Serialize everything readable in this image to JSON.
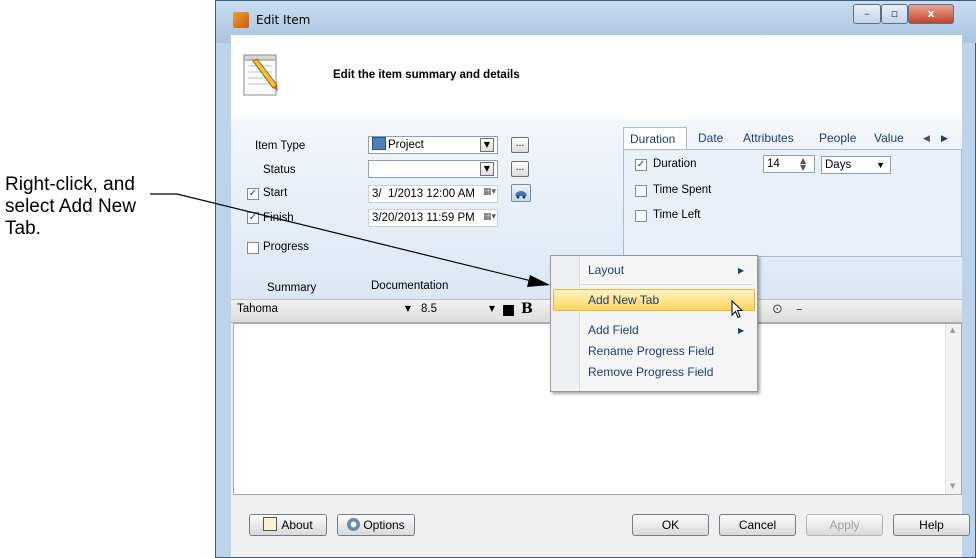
{
  "callout": {
    "line1": "Right-click, and",
    "line2": "select Add New",
    "line3": "Tab."
  },
  "window": {
    "title": "Edit Item",
    "minimize": "–",
    "maximize": "▫",
    "close": "x"
  },
  "header": {
    "text": "Edit the item summary and details"
  },
  "form": {
    "item_type_label": "Item Type",
    "item_type_value": "Project",
    "status_label": "Status",
    "status_value": "",
    "start_label": "Start",
    "start_value": "3/  1/2013 12:00 AM",
    "finish_label": "Finish",
    "finish_value": "3/20/2013 11:59 PM",
    "progress_label": "Progress",
    "summary_label": "Summary",
    "summary_value": "Documentation",
    "ellipsis": "..."
  },
  "tabs": [
    "Duration",
    "Date",
    "Attributes",
    "People",
    "Value"
  ],
  "duration_panel": {
    "duration_label": "Duration",
    "duration_value": "14",
    "unit_value": "Days",
    "time_spent_label": "Time Spent",
    "time_left_label": "Time Left"
  },
  "toolbar": {
    "font": "Tahoma",
    "size": "8.5",
    "bold": "B",
    "dash": "–"
  },
  "context_menu": {
    "items": [
      "Layout",
      "Add New Tab",
      "Add Field",
      "Rename Progress Field",
      "Remove Progress Field"
    ]
  },
  "buttons": {
    "about": "About",
    "options": "Options",
    "ok": "OK",
    "cancel": "Cancel",
    "apply": "Apply",
    "help": "Help"
  }
}
